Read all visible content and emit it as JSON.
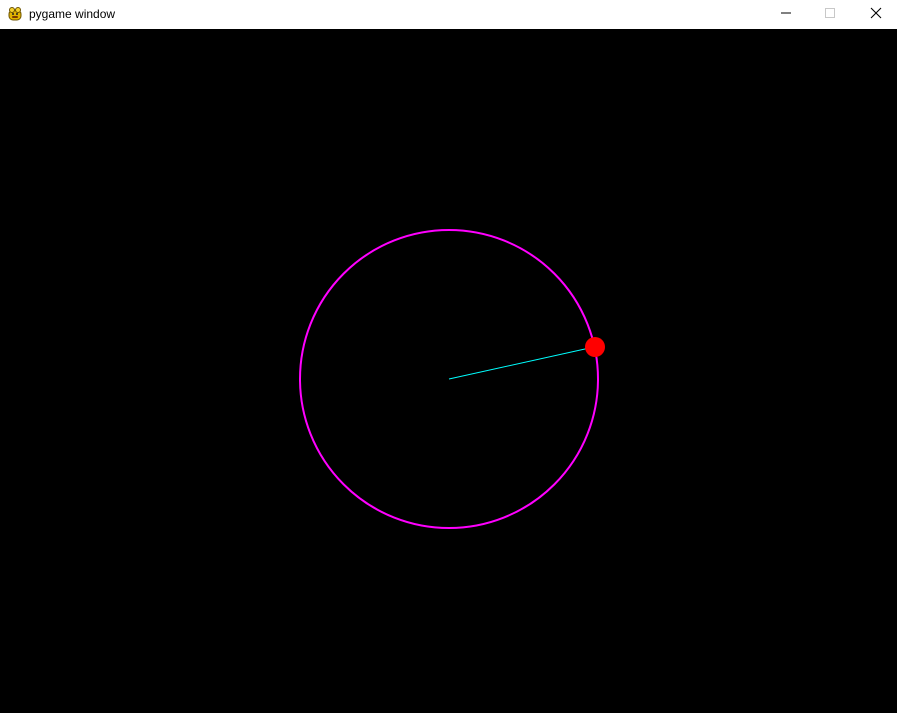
{
  "window": {
    "title": "pygame window",
    "icon": "pygame-snake-icon",
    "controls": {
      "minimize": "minimize-icon",
      "maximize": "maximize-icon",
      "close": "close-icon"
    }
  },
  "scene": {
    "background_color": "#000000",
    "orbit_color": "#ff00ff",
    "radius_line_color": "#00ffff",
    "ball_color": "#ff0000"
  }
}
